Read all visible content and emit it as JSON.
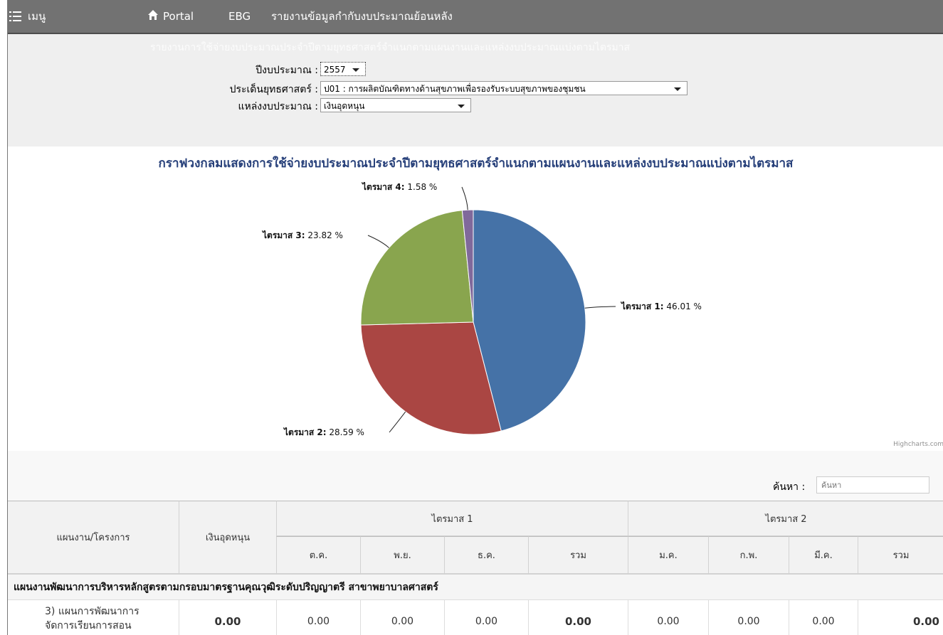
{
  "nav": {
    "menu_label": "เมนู",
    "portal_label": "Portal",
    "ebg_label": "EBG",
    "report_label": "รายงานข้อมูลกำกับงบประมาณย้อนหลัง"
  },
  "filters": {
    "ghost_title": "รายงานการใช้จ่ายงบประมาณประจำปีตามยุทธศาสตร์จำแนกตามแผนงานและแหล่งงบประมาณแบ่งตามไตรมาส",
    "year_label": "ปีงบประมาณ :",
    "year_value": "2557",
    "strategy_label": "ประเด็นยุทธศาสตร์ :",
    "strategy_value": "ป01 : การผลิตบัณฑิตทางด้านสุขภาพเพื่อรองรับระบบสุขภาพของชุมชน",
    "source_label": "แหล่งงบประมาณ :",
    "source_value": "เงินอุดหนุน"
  },
  "chart_data": {
    "type": "pie",
    "title": "กราฟวงกลมแสดงการใช้จ่ายงบประมาณประจำปีตามยุทธศาสตร์จำแนกตามแผนงานและแหล่งงบประมาณแบ่งตามไตรมาส",
    "categories": [
      "ไตรมาส 1",
      "ไตรมาส 2",
      "ไตรมาส 3",
      "ไตรมาส 4"
    ],
    "values": [
      46.01,
      28.59,
      23.82,
      1.58
    ],
    "value_text": [
      "46.01 %",
      "28.59 %",
      "23.82 %",
      "1.58 %"
    ],
    "colors": [
      "#4572a7",
      "#aa4643",
      "#89a54e",
      "#80699b"
    ],
    "credit": "Highcharts.com"
  },
  "search": {
    "label": "ค้นหา :",
    "placeholder": "ค้นหา"
  },
  "table": {
    "col_plan": "แผนงาน/โครงการ",
    "col_source": "เงินอุดหนุน",
    "q1_label": "ไตรมาส 1",
    "q2_label": "ไตรมาส 2",
    "months": [
      "ต.ค.",
      "พ.ย.",
      "ธ.ค.",
      "รวม",
      "ม.ค.",
      "ก.พ.",
      "มี.ค.",
      "รวม"
    ],
    "group_title": "แผนงานพัฒนาการบริหารหลักสูตรตามกรอบมาตรฐานคุณวุฒิระดับปริญญาตรี สาขาพยาบาลศาสตร์",
    "row1": {
      "name_line1": "3) แผนการพัฒนาการ",
      "name_line2": "จัดการเรียนการสอน",
      "values": [
        "0.00",
        "0.00",
        "0.00",
        "0.00",
        "0.00",
        "0.00",
        "0.00",
        "0.00",
        "0.00"
      ]
    }
  }
}
